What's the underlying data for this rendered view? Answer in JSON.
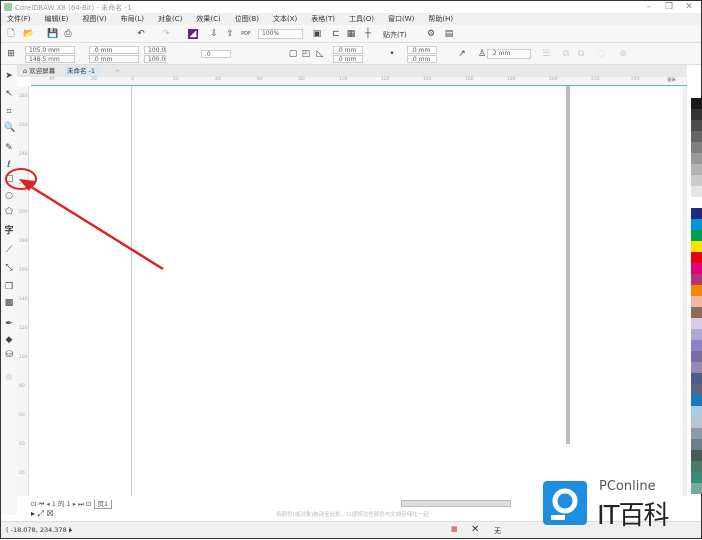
{
  "title": "CorelDRAW X8 (64-Bit) - 未命名 -1",
  "menu": [
    "文件(F)",
    "编辑(E)",
    "视图(V)",
    "布局(L)",
    "对象(C)",
    "效果(C)",
    "位图(B)",
    "文本(X)",
    "表格(T)",
    "工具(O)",
    "窗口(W)",
    "帮助(H)"
  ],
  "toolbar": {
    "zoom": "100%",
    "snap": "贴齐(T)"
  },
  "propbar": {
    "x": "105.0 mm",
    "y": "148.5 mm",
    "w": ".0 mm",
    "h": ".0 mm",
    "sx": "100.0",
    "sy": "100.0",
    "angle": ".0",
    "c1": ".0 mm",
    "c2": ".0 mm",
    "c3": ".0 mm",
    "c4": ".0 mm",
    "outline": ".2 mm"
  },
  "tabs": [
    "欢迎屏幕",
    "未命名 -1"
  ],
  "ruler_h": [
    "40",
    "20",
    "0",
    "20",
    "40",
    "60",
    "80",
    "100",
    "120",
    "140",
    "160",
    "180",
    "200",
    "220",
    "240",
    "毫米"
  ],
  "ruler_v": [
    "280",
    "260",
    "240",
    "220",
    "200",
    "180",
    "160",
    "140",
    "120",
    "100",
    "80",
    "60",
    "40",
    "20"
  ],
  "pagenav": {
    "current": "1",
    "of": "的",
    "total": "1",
    "page_tab": "页1"
  },
  "hint": "将颜色(或对象)拖动至此处，以便将这些颜色与文档存储在一起",
  "status": {
    "coords": "( -18.078, 234.378 )",
    "fill": "无"
  },
  "watermark": {
    "brand": "PConline",
    "name": "IT百科"
  },
  "palette": [
    "#1a1a1a",
    "#333333",
    "#4d4d4d",
    "#666666",
    "#808080",
    "#999999",
    "#b3b3b3",
    "#cccccc",
    "#e6e6e6",
    "#ffffff",
    "#1c2a80",
    "#0098d8",
    "#00a04a",
    "#ffe100",
    "#e60012",
    "#e4007f",
    "#b5357a",
    "#f08a00",
    "#f4b4a8",
    "#8c6a5c",
    "#d8cce6",
    "#b0a6d8",
    "#8a84c6",
    "#7a6aa8",
    "#9488b4",
    "#4c5c8c",
    "#5a6484",
    "#1a78c0",
    "#a8cdeb",
    "#b8c4d0",
    "#8e9aa6",
    "#6e7e8a",
    "#4a5a5a",
    "#4a7a6a",
    "#3a8a7a",
    "#7aa89a"
  ]
}
